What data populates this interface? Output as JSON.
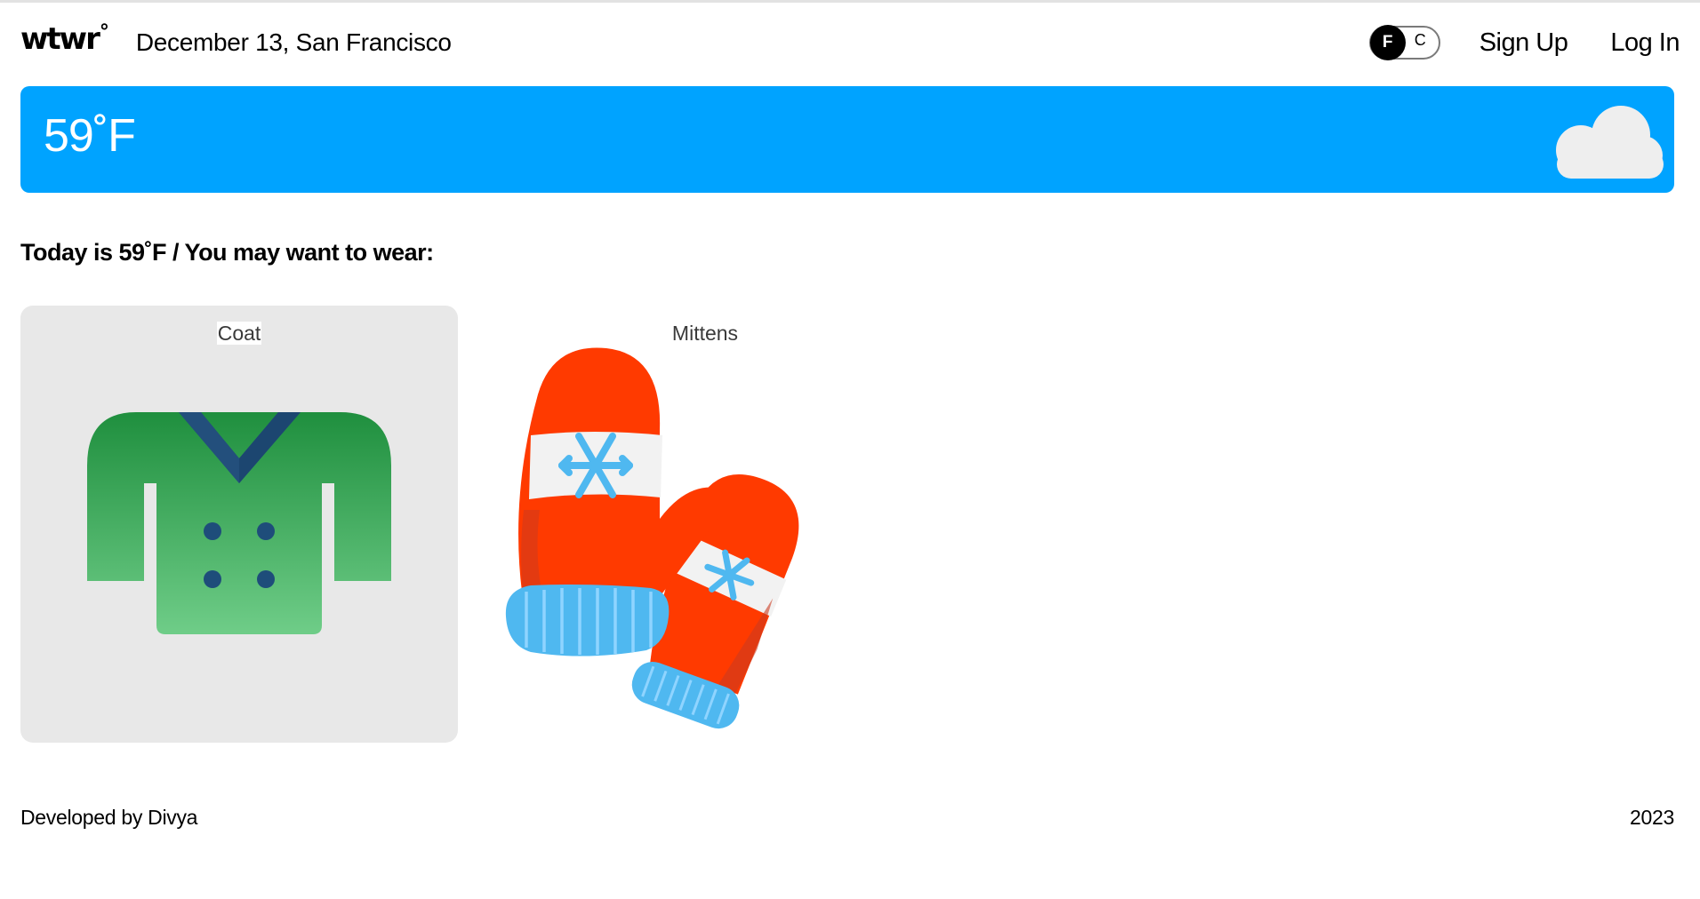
{
  "header": {
    "logo_text": "wtwr",
    "logo_degree": "°",
    "date_location": "December 13, San Francisco",
    "toggle": {
      "active_unit": "F",
      "inactive_unit": "C"
    },
    "sign_up_label": "Sign Up",
    "log_in_label": "Log In"
  },
  "weather_banner": {
    "temperature": "59˚F",
    "condition_icon": "cloud-icon",
    "background_color": "#00a3ff"
  },
  "main": {
    "heading": "Today is 59˚F / You may want to wear:",
    "items": [
      {
        "label": "Coat",
        "icon": "coat-icon"
      },
      {
        "label": "Mittens",
        "icon": "mittens-icon"
      }
    ]
  },
  "footer": {
    "developer_text": "Developed by Divya",
    "year": "2023"
  }
}
